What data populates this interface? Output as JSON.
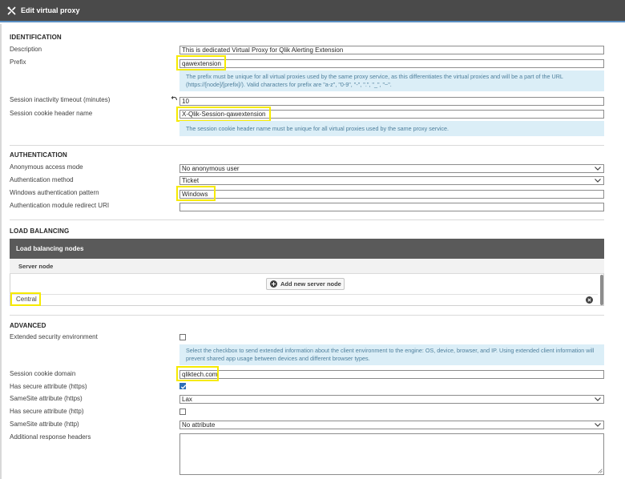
{
  "window": {
    "title": "Edit virtual proxy"
  },
  "identification": {
    "section_title": "IDENTIFICATION",
    "description_label": "Description",
    "description_value": "This is dedicated Virtual Proxy for Qlik Alerting Extension",
    "prefix_label": "Prefix",
    "prefix_value": "qawextension",
    "prefix_info": "The prefix must be unique for all virtual proxies used by the same proxy service, as this differentiates the virtual proxies and will be a part of the URL (https://[node]/[prefix]/). Valid characters for prefix are \"a-z\", \"0-9\", \"-\", \".\", \"_\", \"~\".",
    "timeout_label": "Session inactivity timeout (minutes)",
    "timeout_value": "10",
    "cookie_header_label": "Session cookie header name",
    "cookie_header_value": "X-Qlik-Session-qawextension",
    "cookie_header_info": "The session cookie header name must be unique for all virtual proxies used by the same proxy service."
  },
  "authentication": {
    "section_title": "AUTHENTICATION",
    "anon_label": "Anonymous access mode",
    "anon_value": "No anonymous user",
    "method_label": "Authentication method",
    "method_value": "Ticket",
    "pattern_label": "Windows authentication pattern",
    "pattern_value": "Windows",
    "redirect_label": "Authentication module redirect URI",
    "redirect_value": ""
  },
  "load_balancing": {
    "section_title": "LOAD BALANCING",
    "panel_title": "Load balancing nodes",
    "column_header": "Server node",
    "add_button": "Add new server node",
    "nodes": [
      "Central"
    ]
  },
  "advanced": {
    "section_title": "ADVANCED",
    "ext_security_label": "Extended security environment",
    "ext_security_checked": false,
    "ext_security_info": "Select the checkbox to send extended information about the client environment to the engine: OS, device, browser, and IP. Using extended client information will prevent shared app usage between devices and different browser types.",
    "cookie_domain_label": "Session cookie domain",
    "cookie_domain_value": "qliktech.com",
    "secure_https_label": "Has secure attribute (https)",
    "secure_https_checked": true,
    "samesite_https_label": "SameSite attribute (https)",
    "samesite_https_value": "Lax",
    "secure_http_label": "Has secure attribute (http)",
    "secure_http_checked": false,
    "samesite_http_label": "SameSite attribute (http)",
    "samesite_http_value": "No attribute",
    "response_headers_label": "Additional response headers",
    "response_headers_value": ""
  },
  "icons": {
    "title_icon": "tools-icon",
    "undo_icon": "undo-icon",
    "add_icon": "plus-circle-icon",
    "remove_icon": "close-circle-icon"
  },
  "colors": {
    "titlebar": "#4a4a4a",
    "accent": "#5a8fc4",
    "info_bg": "#dbeef7",
    "highlight": "#f6ea00",
    "checkbox_on": "#2d6fb8"
  }
}
